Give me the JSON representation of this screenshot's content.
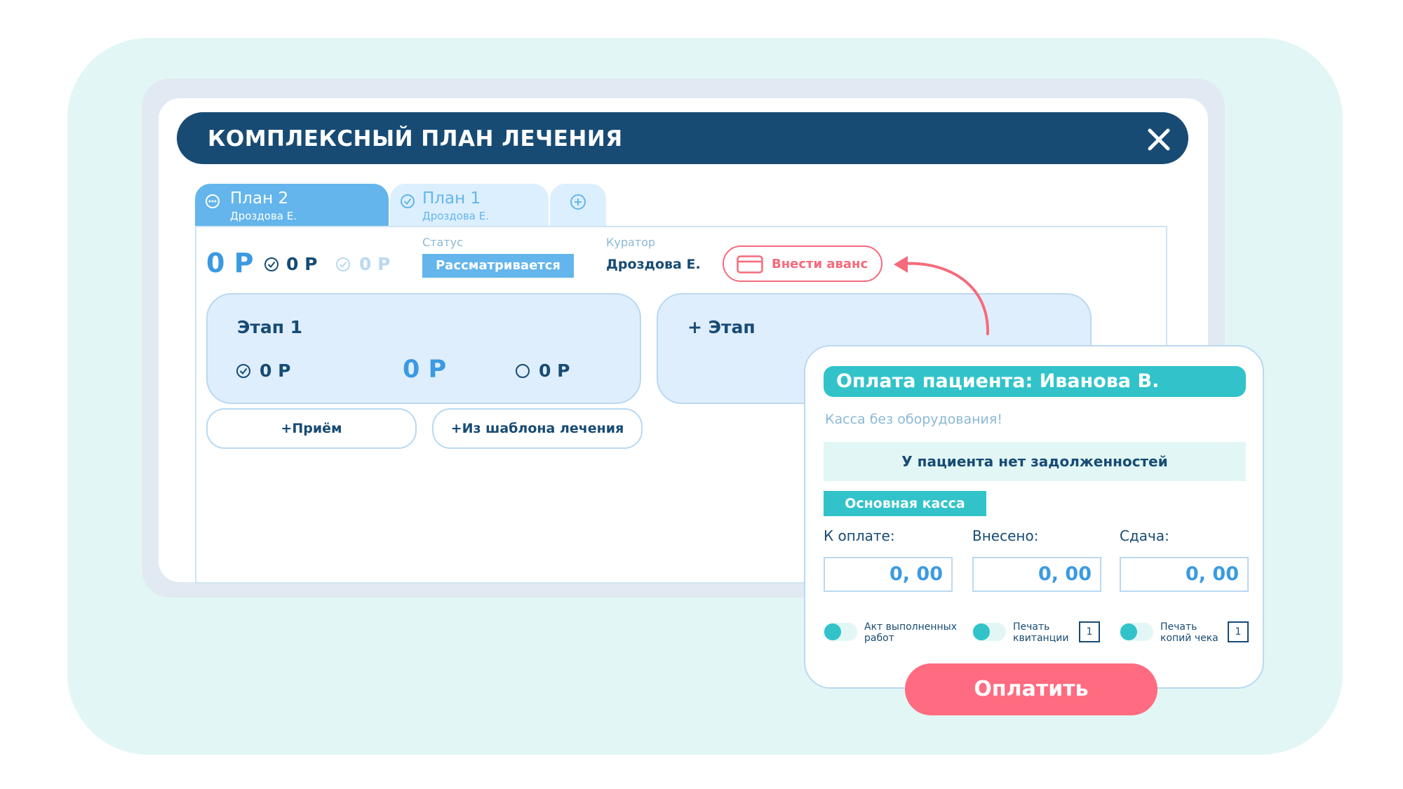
{
  "window": {
    "title": "КОМПЛЕКСНЫЙ ПЛАН ЛЕЧЕНИЯ"
  },
  "tabs": [
    {
      "title": "План 2",
      "subtitle": "Дроздова Е.",
      "active": true
    },
    {
      "title": "План 1",
      "subtitle": "Дроздова Е.",
      "active": false
    }
  ],
  "summary": {
    "total": "0 Р",
    "paid": "0 Р",
    "completed": "0 Р",
    "status_label": "Статус",
    "status_value": "Рассматривается",
    "curator_label": "Куратор",
    "curator_value": "Дроздова Е.",
    "advance_button": "Внести аванс"
  },
  "stages": [
    {
      "title": "Этап 1",
      "paid": "0 Р",
      "total": "0 Р",
      "remaining": "0 Р"
    }
  ],
  "add_stage_label": "+ Этап",
  "actions": {
    "add_visit": "+Приём",
    "from_template": "+Из шаблона лечения"
  },
  "payment": {
    "title": "Оплата пациента: Иванова В.",
    "warning": "Касса без оборудования!",
    "debt_message": "У пациента нет задолженностей",
    "cashbox": "Основная касса",
    "fields": [
      {
        "label": "К оплате:",
        "value": "0, 00"
      },
      {
        "label": "Внесено:",
        "value": "0, 00"
      },
      {
        "label": "Сдача:",
        "value": "0, 00"
      }
    ],
    "toggles": [
      {
        "label_line1": "Акт выполненных",
        "label_line2": "работ"
      },
      {
        "label_line1": "Печать",
        "label_line2": "квитанции",
        "count": "1"
      },
      {
        "label_line1": "Печать",
        "label_line2": "копий чека",
        "count": "1"
      }
    ],
    "pay_button": "Оплатить"
  },
  "colors": {
    "navy": "#174b74",
    "blue": "#3b9ae1",
    "light_blue": "#64b5ec",
    "teal": "#31c3c9",
    "pink": "#ff6b80",
    "mint_bg": "#e2f7f5"
  },
  "icons": [
    "close-icon",
    "more-icon",
    "check-circle-icon",
    "plus-circle-icon",
    "credit-card-icon",
    "circle-icon",
    "arrow-icon"
  ]
}
